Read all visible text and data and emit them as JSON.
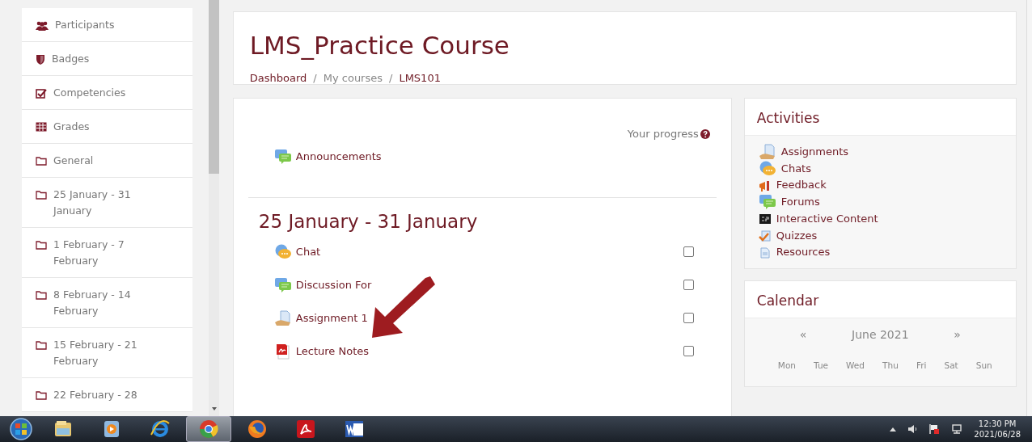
{
  "sidebar": {
    "items": [
      {
        "label": "Participants",
        "kind": "people"
      },
      {
        "label": "Badges",
        "kind": "shield"
      },
      {
        "label": "Competencies",
        "kind": "checkbox"
      },
      {
        "label": "Grades",
        "kind": "table"
      },
      {
        "label": "General",
        "kind": "folder"
      },
      {
        "label": "25 January - 31 January",
        "kind": "folder"
      },
      {
        "label": "1 February - 7 February",
        "kind": "folder"
      },
      {
        "label": "8 February - 14 February",
        "kind": "folder"
      },
      {
        "label": "15 February - 21 February",
        "kind": "folder"
      },
      {
        "label": "22 February - 28",
        "kind": "folder"
      }
    ]
  },
  "header": {
    "title": "LMS_Practice Course",
    "separator": "/",
    "breadcrumb": [
      {
        "label": "Dashboard",
        "kind": "link"
      },
      {
        "label": "My courses",
        "kind": "plain"
      },
      {
        "label": "LMS101",
        "kind": "link"
      }
    ]
  },
  "course": {
    "progress_label": "Your progress",
    "general": [
      {
        "label": "Announcements",
        "kind": "forum"
      }
    ],
    "sections": [
      {
        "title": "25 January - 31 January",
        "activities": [
          {
            "label": "Chat",
            "kind": "chat",
            "completed": false
          },
          {
            "label": "Discussion For",
            "kind": "forum",
            "completed": false
          },
          {
            "label": "Assignment 1",
            "kind": "assignment",
            "completed": false
          },
          {
            "label": "Lecture Notes",
            "kind": "pdf",
            "completed": false
          }
        ]
      }
    ]
  },
  "activities_block": {
    "title": "Activities",
    "items": [
      {
        "label": "Assignments",
        "kind": "assignment"
      },
      {
        "label": "Chats",
        "kind": "chat"
      },
      {
        "label": "Feedback",
        "kind": "feedback"
      },
      {
        "label": "Forums",
        "kind": "forum"
      },
      {
        "label": "Interactive Content",
        "kind": "h5p"
      },
      {
        "label": "Quizzes",
        "kind": "quiz"
      },
      {
        "label": "Resources",
        "kind": "file"
      }
    ]
  },
  "calendar": {
    "title": "Calendar",
    "prev": "«",
    "month": "June 2021",
    "next": "»",
    "weekdays": [
      "Mon",
      "Tue",
      "Wed",
      "Thu",
      "Fri",
      "Sat",
      "Sun"
    ]
  },
  "taskbar": {
    "apps": [
      {
        "kind": "explorer",
        "selected": false
      },
      {
        "kind": "media",
        "selected": false
      },
      {
        "kind": "ie",
        "selected": false
      },
      {
        "kind": "chrome",
        "selected": true
      },
      {
        "kind": "firefox",
        "selected": false
      },
      {
        "kind": "acrobat",
        "selected": false
      },
      {
        "kind": "word",
        "selected": false
      }
    ],
    "time": "12:30 PM",
    "date": "2021/06/28"
  }
}
